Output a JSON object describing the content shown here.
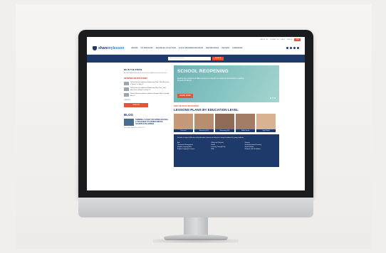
{
  "topbar": {
    "links": [
      "ABOUT US",
      "CONTACT US",
      "FAQS"
    ],
    "signin": "SIGN IN",
    "join": "JOIN"
  },
  "header": {
    "logo_main": "share",
    "logo_accent": "mylesson",
    "nav": [
      "BROWSE",
      "TOP RESOURCES",
      "NEA SPECIAL COLLECTIONS",
      "SCHOOL REOPENING RESOURCES",
      "NEW RESOURCES",
      "TEACHERS",
      "COMMUNITIES"
    ]
  },
  "search": {
    "placeholder": "Search resources here...",
    "button": "SEARCH"
  },
  "sidebar": {
    "know_heading": "BE IN THE KNOW",
    "know_text": "See the latest lesson plans and resource updates from our partners.",
    "notif_heading": "NETWORK NOTIFICATIONS",
    "notifications": [
      {
        "text": "Jeffrey Hancock published Wednesday Free: “I Am More than a Weight” on May 27"
      },
      {
        "text": "Jeffrey Hancock published Wednesday Wins Free: “I Am More than a Weight” on May 27"
      },
      {
        "text": "National Education Assoc. published Preview Week 6 through May 27"
      }
    ],
    "view_all": "VIEW ALL",
    "join_button": "JOIN US",
    "blog_heading": "BLOG",
    "blog_title": "SHINING A LIGHT ON HONG DAZHAI, A TEACHER AT KAMEHAMEHA SCHOOLS IN HAWAII",
    "blog_meta": "Shareable Spotlight | 2020-05-27"
  },
  "hero": {
    "title": "SCHOOL REOPENING",
    "subtitle": "Explore free resources & NEA resources to support our students and schools in learning beyond COVID-19.",
    "button": "LEARN MORE"
  },
  "lessons": {
    "find_text": "FIND THE RIGHT RESOURCES",
    "title": "LESSONS PLANS BY EDUCATION LEVEL",
    "grades": [
      {
        "label": "Preschool",
        "color": "#c49a7a"
      },
      {
        "label": "Elementary (K-5)",
        "color": "#b78e6e"
      },
      {
        "label": "Elementary (6-8)",
        "color": "#8f6a54"
      },
      {
        "label": "Middle School",
        "color": "#a37c66"
      },
      {
        "label": "High School",
        "color": "#d8b291"
      }
    ]
  },
  "subjects": {
    "intro": "Includes a range of effective early education resources to help set a strong foundation for young students.",
    "items": [
      "Arts",
      "Gifted and Talented",
      "Science",
      "Classroom Management",
      "Health",
      "Social-Emotional Learning",
      "English Language Arts",
      "Learning Through Play",
      "Social Studies",
      "English Language Learners",
      "Math",
      "Students with Disabilities"
    ]
  },
  "colors": {
    "navy": "#1e3a6b",
    "accent": "#e2553a",
    "hero_teal": "#6fb2b6"
  }
}
